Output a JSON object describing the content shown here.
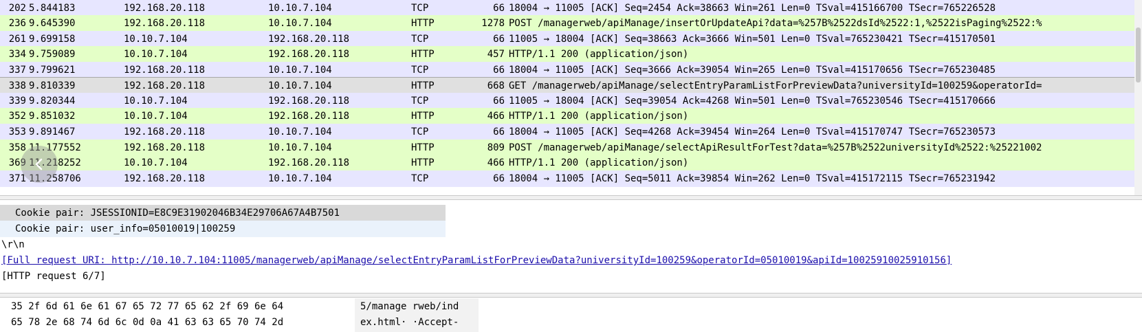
{
  "packets": [
    {
      "no": "202",
      "time": "5.844183",
      "src": "192.168.20.118",
      "dst": "10.10.7.104",
      "proto": "TCP",
      "len": "66",
      "info": "18004 → 11005 [ACK] Seq=2454 Ack=38663 Win=261 Len=0 TSval=415166700 TSecr=765226528"
    },
    {
      "no": "236",
      "time": "9.645390",
      "src": "192.168.20.118",
      "dst": "10.10.7.104",
      "proto": "HTTP",
      "len": "1278",
      "info": "POST /managerweb/apiManage/insertOrUpdateApi?data=%257B%2522dsId%2522:1,%2522isPaging%2522:%"
    },
    {
      "no": "261",
      "time": "9.699158",
      "src": "10.10.7.104",
      "dst": "192.168.20.118",
      "proto": "TCP",
      "len": "66",
      "info": "11005 → 18004 [ACK] Seq=38663 Ack=3666 Win=501 Len=0 TSval=765230421 TSecr=415170501"
    },
    {
      "no": "334",
      "time": "9.759089",
      "src": "10.10.7.104",
      "dst": "192.168.20.118",
      "proto": "HTTP",
      "len": "457",
      "info": "HTTP/1.1 200   (application/json)"
    },
    {
      "no": "337",
      "time": "9.799621",
      "src": "192.168.20.118",
      "dst": "10.10.7.104",
      "proto": "TCP",
      "len": "66",
      "info": "18004 → 11005 [ACK] Seq=3666 Ack=39054 Win=265 Len=0 TSval=415170656 TSecr=765230485"
    },
    {
      "no": "338",
      "time": "9.810339",
      "src": "192.168.20.118",
      "dst": "10.10.7.104",
      "proto": "HTTP",
      "len": "668",
      "info": "GET /managerweb/apiManage/selectEntryParamListForPreviewData?universityId=100259&operatorId="
    },
    {
      "no": "339",
      "time": "9.820344",
      "src": "10.10.7.104",
      "dst": "192.168.20.118",
      "proto": "TCP",
      "len": "66",
      "info": "11005 → 18004 [ACK] Seq=39054 Ack=4268 Win=501 Len=0 TSval=765230546 TSecr=415170666"
    },
    {
      "no": "352",
      "time": "9.851032",
      "src": "10.10.7.104",
      "dst": "192.168.20.118",
      "proto": "HTTP",
      "len": "466",
      "info": "HTTP/1.1 200   (application/json)"
    },
    {
      "no": "353",
      "time": "9.891467",
      "src": "192.168.20.118",
      "dst": "10.10.7.104",
      "proto": "TCP",
      "len": "66",
      "info": "18004 → 11005 [ACK] Seq=4268 Ack=39454 Win=264 Len=0 TSval=415170747 TSecr=765230573"
    },
    {
      "no": "358",
      "time": "11.177552",
      "src": "192.168.20.118",
      "dst": "10.10.7.104",
      "proto": "HTTP",
      "len": "809",
      "info": "POST /managerweb/apiManage/selectApiResultForTest?data=%257B%2522universityId%2522:%25221002"
    },
    {
      "no": "369",
      "time": "11.218252",
      "src": "10.10.7.104",
      "dst": "192.168.20.118",
      "proto": "HTTP",
      "len": "466",
      "info": "HTTP/1.1 200   (application/json)"
    },
    {
      "no": "371",
      "time": "11.258706",
      "src": "192.168.20.118",
      "dst": "10.10.7.104",
      "proto": "TCP",
      "len": "66",
      "info": "18004 → 11005 [ACK] Seq=5011 Ack=39854 Win=262 Len=0 TSval=415172115 TSecr=765231942"
    }
  ],
  "colors": {
    "tcp_row": "#e7e6ff",
    "http_row": "#e4ffc7",
    "selected_row": "#e0e0e0",
    "link": "#1a0dab"
  },
  "back_icon": "chevron-left-icon",
  "details": {
    "cookie1": "Cookie pair: JSESSIONID=E8C9E31902046B34E29706A67A4B7501",
    "cookie2": "Cookie pair: user_info=05010019|100259",
    "crlf": "\\r\\n",
    "full_uri": "[Full request URI: http://10.10.7.104:11005/managerweb/apiManage/selectEntryParamListForPreviewData?universityId=100259&operatorId=05010019&apiId=10025910025910156]",
    "request_num": "[HTTP request 6/7]"
  },
  "hex": [
    {
      "bytes": "35 2f 6d 61 6e 61 67 65  72 77 65 62 2f 69 6e 64",
      "ascii": "5/manage rweb/ind"
    },
    {
      "bytes": "65 78 2e 68 74 6d 6c 0d  0a 41 63 63 65 70 74 2d",
      "ascii": "ex.html· ·Accept-"
    }
  ]
}
